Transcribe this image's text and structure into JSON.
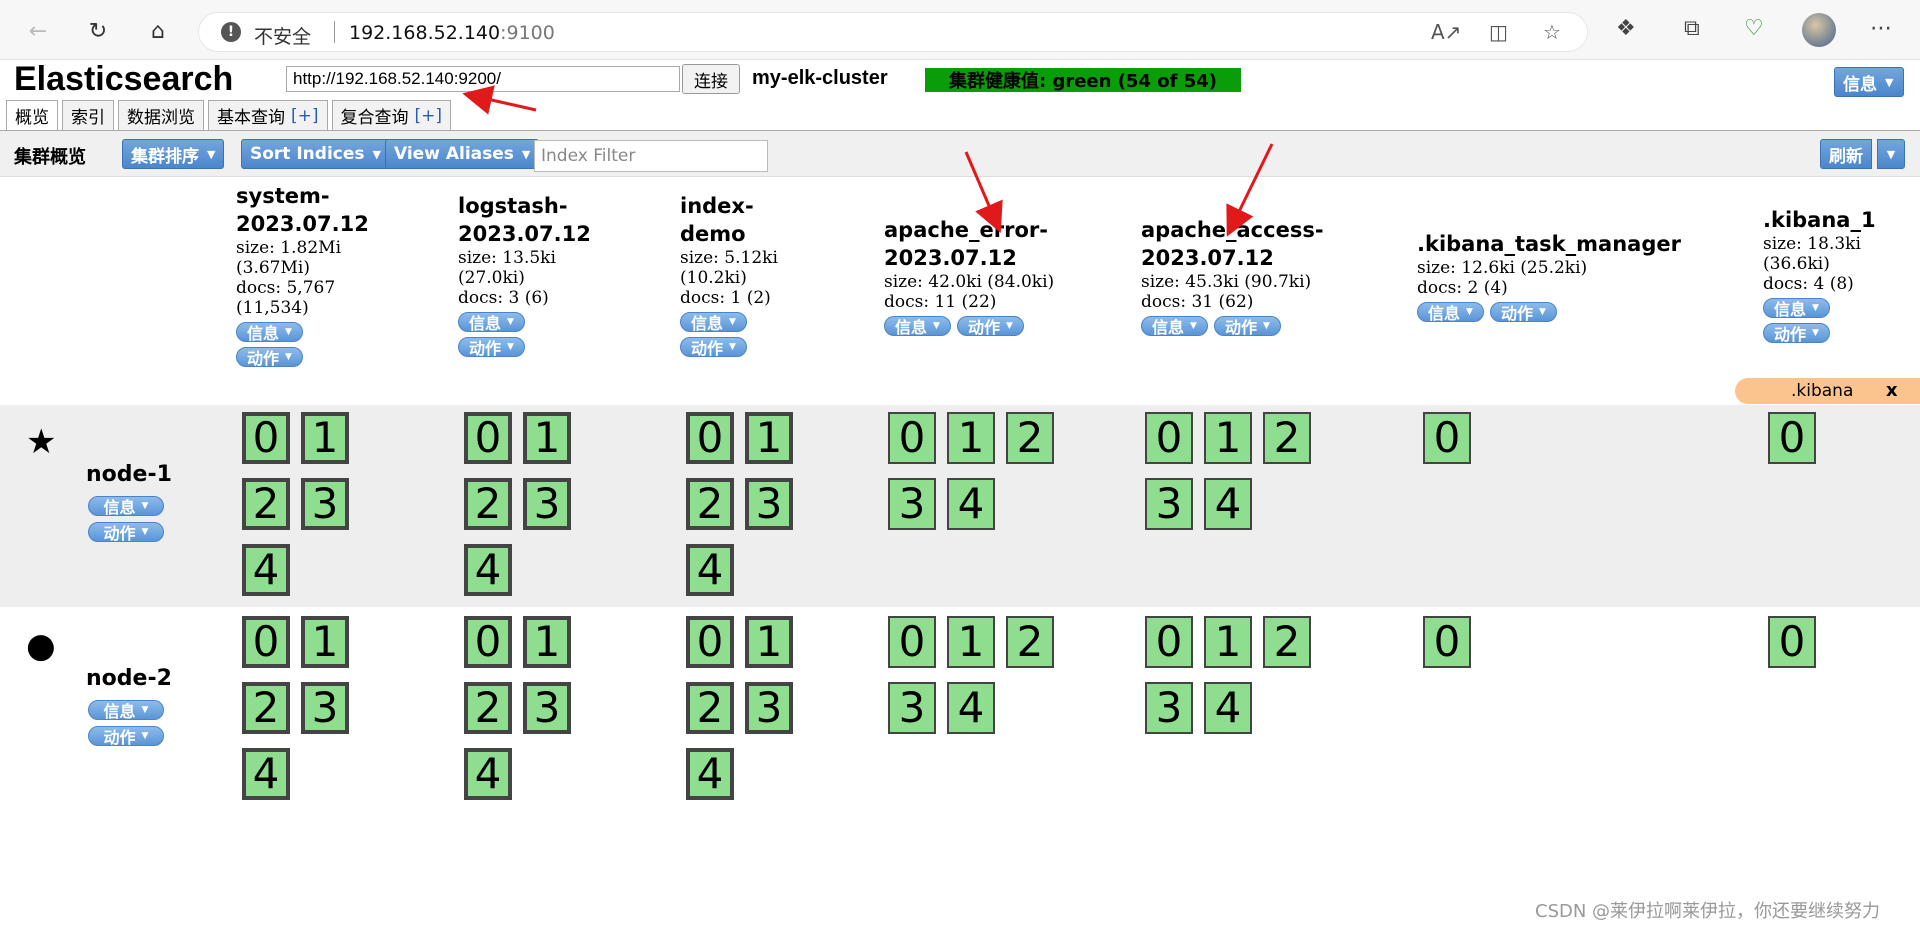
{
  "browser": {
    "security_label": "不安全",
    "url_host": "192.168.52.140",
    "url_port": ":9100"
  },
  "app": {
    "title": "Elasticsearch",
    "connect_url": "http://192.168.52.140:9200/",
    "connect_button": "连接",
    "cluster_name": "my-elk-cluster",
    "health": "集群健康值: green (54 of 54)",
    "info_button": "信息"
  },
  "tabs": [
    {
      "label": "概览",
      "plus": ""
    },
    {
      "label": "索引",
      "plus": ""
    },
    {
      "label": "数据浏览",
      "plus": ""
    },
    {
      "label": "基本查询",
      "plus": "[+]"
    },
    {
      "label": "复合查询",
      "plus": "[+]"
    }
  ],
  "toolbar": {
    "title": "集群概览",
    "sort_cluster": "集群排序",
    "sort_indices": "Sort Indices",
    "view_aliases": "View Aliases",
    "filter_placeholder": "Index Filter",
    "refresh": "刷新"
  },
  "pill_labels": {
    "info": "信息",
    "action": "动作"
  },
  "indices": [
    {
      "name": "system-2023.07.12",
      "meta": [
        "size: 1.82Mi",
        "(3.67Mi)",
        "docs: 5,767",
        "(11,534)"
      ]
    },
    {
      "name": "logstash-2023.07.12",
      "meta": [
        "size: 13.5ki",
        "(27.0ki)",
        "docs: 3 (6)"
      ]
    },
    {
      "name": "index-demo",
      "meta": [
        "size: 5.12ki",
        "(10.2ki)",
        "docs: 1 (2)"
      ]
    },
    {
      "name": "apache_error-2023.07.12",
      "meta": [
        "size: 42.0ki (84.0ki)",
        "docs: 11 (22)"
      ]
    },
    {
      "name": "apache_access-2023.07.12",
      "meta": [
        "size: 45.3ki (90.7ki)",
        "docs: 31 (62)"
      ]
    },
    {
      "name": ".kibana_task_manager",
      "meta": [
        "size: 12.6ki (25.2ki)",
        "docs: 2 (4)"
      ]
    },
    {
      "name": ".kibana_1",
      "meta": [
        "size: 18.3ki",
        "(36.6ki)",
        "docs: 4 (8)"
      ]
    }
  ],
  "alias_badge": {
    "label": ".kibana",
    "close": "x"
  },
  "nodes": [
    {
      "name": "node-1",
      "icon": "star-icon",
      "glyph": "★"
    },
    {
      "name": "node-2",
      "icon": "circle-icon",
      "glyph": "●"
    }
  ],
  "shards": {
    "five": [
      "0",
      "1",
      "2",
      "3",
      "4"
    ],
    "one": [
      "0"
    ]
  },
  "watermark": "CSDN @莱伊拉啊莱伊拉，你还要继续努力",
  "colors": {
    "health_green": "#0a9d0a",
    "shard_green": "#8fde8f",
    "button_blue": "#4b86cc",
    "alias_orange": "#fbc48e"
  }
}
